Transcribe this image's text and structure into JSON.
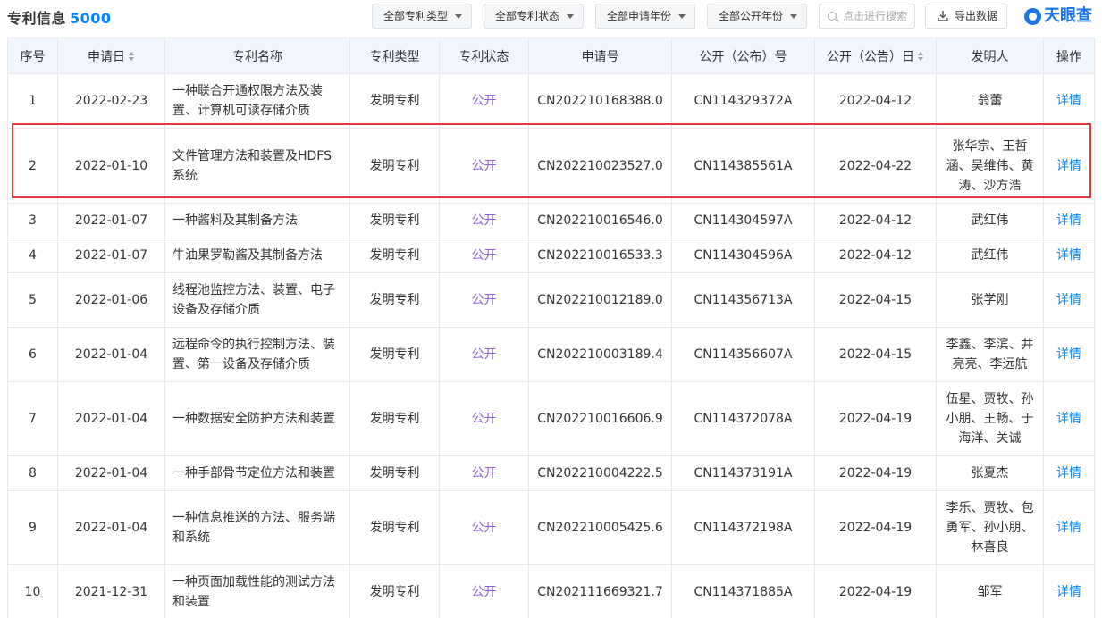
{
  "header": {
    "title": "专利信息",
    "count": "5000"
  },
  "filters": [
    {
      "label": "全部专利类型"
    },
    {
      "label": "全部专利状态"
    },
    {
      "label": "全部申请年份"
    },
    {
      "label": "全部公开年份"
    }
  ],
  "search": {
    "placeholder": "点击进行搜索"
  },
  "export": {
    "label": "导出数据"
  },
  "brand": {
    "name": "天眼查"
  },
  "colors": {
    "accent": "#0084ff",
    "status": "#8e5ed4",
    "header_bg": "#f0f5fe",
    "highlight": "#e03a3a"
  },
  "table": {
    "columns": [
      "序号",
      "申请日",
      "专利名称",
      "专利类型",
      "专利状态",
      "申请号",
      "公开（公布）号",
      "公开（公告）日",
      "发明人",
      "操作"
    ],
    "rows": [
      {
        "no": "1",
        "apply_date": "2022-02-23",
        "name": "一种联合开通权限方法及装置、计算机可读存储介质",
        "type": "发明专利",
        "status": "公开",
        "apply_no": "CN202210168388.0",
        "pub_no": "CN114329372A",
        "pub_date": "2022-04-12",
        "inventor": "翁蕾",
        "action": "详情"
      },
      {
        "no": "2",
        "apply_date": "2022-01-10",
        "name": "文件管理方法和装置及HDFS系统",
        "type": "发明专利",
        "status": "公开",
        "apply_no": "CN202210023527.0",
        "pub_no": "CN114385561A",
        "pub_date": "2022-04-22",
        "inventor": "张华宗、王哲涵、吴维伟、黄涛、沙方浩",
        "action": "详情"
      },
      {
        "no": "3",
        "apply_date": "2022-01-07",
        "name": "一种酱料及其制备方法",
        "type": "发明专利",
        "status": "公开",
        "apply_no": "CN202210016546.0",
        "pub_no": "CN114304597A",
        "pub_date": "2022-04-12",
        "inventor": "武红伟",
        "action": "详情"
      },
      {
        "no": "4",
        "apply_date": "2022-01-07",
        "name": "牛油果罗勒酱及其制备方法",
        "type": "发明专利",
        "status": "公开",
        "apply_no": "CN202210016533.3",
        "pub_no": "CN114304596A",
        "pub_date": "2022-04-12",
        "inventor": "武红伟",
        "action": "详情"
      },
      {
        "no": "5",
        "apply_date": "2022-01-06",
        "name": "线程池监控方法、装置、电子设备及存储介质",
        "type": "发明专利",
        "status": "公开",
        "apply_no": "CN202210012189.0",
        "pub_no": "CN114356713A",
        "pub_date": "2022-04-15",
        "inventor": "张学刚",
        "action": "详情"
      },
      {
        "no": "6",
        "apply_date": "2022-01-04",
        "name": "远程命令的执行控制方法、装置、第一设备及存储介质",
        "type": "发明专利",
        "status": "公开",
        "apply_no": "CN202210003189.4",
        "pub_no": "CN114356607A",
        "pub_date": "2022-04-15",
        "inventor": "李鑫、李滨、井亮亮、李远航",
        "action": "详情"
      },
      {
        "no": "7",
        "apply_date": "2022-01-04",
        "name": "一种数据安全防护方法和装置",
        "type": "发明专利",
        "status": "公开",
        "apply_no": "CN202210016606.9",
        "pub_no": "CN114372078A",
        "pub_date": "2022-04-19",
        "inventor": "伍星、贾牧、孙小朋、王畅、于海洋、关诚",
        "action": "详情"
      },
      {
        "no": "8",
        "apply_date": "2022-01-04",
        "name": "一种手部骨节定位方法和装置",
        "type": "发明专利",
        "status": "公开",
        "apply_no": "CN202210004222.5",
        "pub_no": "CN114373191A",
        "pub_date": "2022-04-19",
        "inventor": "张夏杰",
        "action": "详情"
      },
      {
        "no": "9",
        "apply_date": "2022-01-04",
        "name": "一种信息推送的方法、服务端和系统",
        "type": "发明专利",
        "status": "公开",
        "apply_no": "CN202210005425.6",
        "pub_no": "CN114372198A",
        "pub_date": "2022-04-19",
        "inventor": "李乐、贾牧、包勇军、孙小朋、林喜良",
        "action": "详情"
      },
      {
        "no": "10",
        "apply_date": "2021-12-31",
        "name": "一种页面加载性能的测试方法和装置",
        "type": "发明专利",
        "status": "公开",
        "apply_no": "CN202111669321.7",
        "pub_no": "CN114371885A",
        "pub_date": "2022-04-19",
        "inventor": "邹军",
        "action": "详情"
      }
    ]
  }
}
